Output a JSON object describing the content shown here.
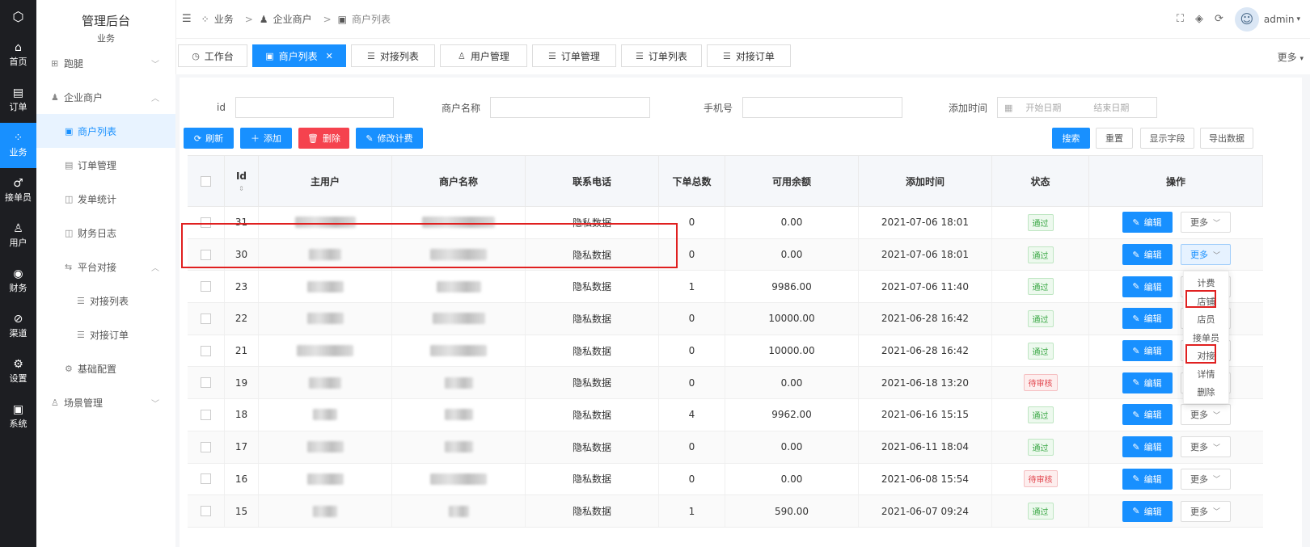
{
  "rail": [
    {
      "icon": "home-icon",
      "glyph": "⌂",
      "label": "首页"
    },
    {
      "icon": "order-icon",
      "glyph": "▤",
      "label": "订单"
    },
    {
      "icon": "business-icon",
      "glyph": "⁘",
      "label": "业务"
    },
    {
      "icon": "bike-icon",
      "glyph": "♂",
      "label": "接单员"
    },
    {
      "icon": "user-icon",
      "glyph": "♙",
      "label": "用户"
    },
    {
      "icon": "finance-icon",
      "glyph": "◉",
      "label": "财务"
    },
    {
      "icon": "channel-icon",
      "glyph": "⊘",
      "label": "渠道"
    },
    {
      "icon": "settings-icon",
      "glyph": "⚙",
      "label": "设置"
    },
    {
      "icon": "system-icon",
      "glyph": "▣",
      "label": "系统"
    }
  ],
  "sidebar": {
    "title": "管理后台",
    "subtitle": "业务",
    "items": [
      {
        "label": "跑腿",
        "icon": "run-icon",
        "glyph": "⊞"
      },
      {
        "label": "企业商户",
        "icon": "enterprise-icon",
        "glyph": "♟"
      },
      {
        "label": "商户列表",
        "icon": "merchant-list-icon",
        "glyph": "▣"
      },
      {
        "label": "订单管理",
        "icon": "order-manage-icon",
        "glyph": "▤"
      },
      {
        "label": "发单统计",
        "icon": "stats-icon",
        "glyph": "◫"
      },
      {
        "label": "财务日志",
        "icon": "log-icon",
        "glyph": "◫"
      },
      {
        "label": "平台对接",
        "icon": "platform-icon",
        "glyph": "⇆"
      },
      {
        "label": "对接列表",
        "icon": "list-icon",
        "glyph": "☰"
      },
      {
        "label": "对接订单",
        "icon": "list2-icon",
        "glyph": "☰"
      },
      {
        "label": "基础配置",
        "icon": "config-icon",
        "glyph": "⚙"
      },
      {
        "label": "场景管理",
        "icon": "scene-icon",
        "glyph": "♙"
      }
    ]
  },
  "header": {
    "breadcrumb": [
      "业务",
      "企业商户",
      "商户列表"
    ],
    "user": "admin"
  },
  "tabs": [
    {
      "label": "工作台",
      "glyph": "◷"
    },
    {
      "label": "商户列表",
      "glyph": "▣"
    },
    {
      "label": "对接列表",
      "glyph": "☰"
    },
    {
      "label": "用户管理",
      "glyph": "♙"
    },
    {
      "label": "订单管理",
      "glyph": "☰"
    },
    {
      "label": "订单列表",
      "glyph": "☰"
    },
    {
      "label": "对接订单",
      "glyph": "☰"
    }
  ],
  "tabs_more": "更多",
  "search": {
    "id_label": "id",
    "name_label": "商户名称",
    "phone_label": "手机号",
    "time_label": "添加时间",
    "start_placeholder": "开始日期",
    "end_placeholder": "结束日期"
  },
  "buttons": {
    "refresh": "刷新",
    "add": "添加",
    "delete": "删除",
    "edit_fee": "修改计费",
    "search": "搜索",
    "reset": "重置",
    "fields": "显示字段",
    "export": "导出数据"
  },
  "table": {
    "headers": [
      "Id",
      "主用户",
      "商户名称",
      "联系电话",
      "下单总数",
      "可用余额",
      "添加时间",
      "状态",
      "操作"
    ],
    "edit_label": "编辑",
    "more_label": "更多",
    "rows": [
      {
        "id": "31",
        "phone": "隐私数据",
        "orders": "0",
        "balance": "0.00",
        "time": "2021-07-06 18:01",
        "status": "通过",
        "ok": true
      },
      {
        "id": "30",
        "phone": "隐私数据",
        "orders": "0",
        "balance": "0.00",
        "time": "2021-07-06 18:01",
        "status": "通过",
        "ok": true
      },
      {
        "id": "23",
        "phone": "隐私数据",
        "orders": "1",
        "balance": "9986.00",
        "time": "2021-07-06 11:40",
        "status": "通过",
        "ok": true
      },
      {
        "id": "22",
        "phone": "隐私数据",
        "orders": "0",
        "balance": "10000.00",
        "time": "2021-06-28 16:42",
        "status": "通过",
        "ok": true
      },
      {
        "id": "21",
        "phone": "隐私数据",
        "orders": "0",
        "balance": "10000.00",
        "time": "2021-06-28 16:42",
        "status": "通过",
        "ok": true
      },
      {
        "id": "19",
        "phone": "隐私数据",
        "orders": "0",
        "balance": "0.00",
        "time": "2021-06-18 13:20",
        "status": "待审核",
        "ok": false
      },
      {
        "id": "18",
        "phone": "隐私数据",
        "orders": "4",
        "balance": "9962.00",
        "time": "2021-06-16 15:15",
        "status": "通过",
        "ok": true
      },
      {
        "id": "17",
        "phone": "隐私数据",
        "orders": "0",
        "balance": "0.00",
        "time": "2021-06-11 18:04",
        "status": "通过",
        "ok": true
      },
      {
        "id": "16",
        "phone": "隐私数据",
        "orders": "0",
        "balance": "0.00",
        "time": "2021-06-08 15:54",
        "status": "待审核",
        "ok": false
      },
      {
        "id": "15",
        "phone": "隐私数据",
        "orders": "1",
        "balance": "590.00",
        "time": "2021-06-07 09:24",
        "status": "通过",
        "ok": true
      }
    ]
  },
  "dropdown": [
    "计费",
    "店铺",
    "店员",
    "接单员",
    "对接",
    "详情",
    "删除"
  ],
  "colors": {
    "primary": "#1890ff",
    "danger": "#f5424e",
    "rail": "#1d1e22",
    "annotation": "#e02020"
  }
}
